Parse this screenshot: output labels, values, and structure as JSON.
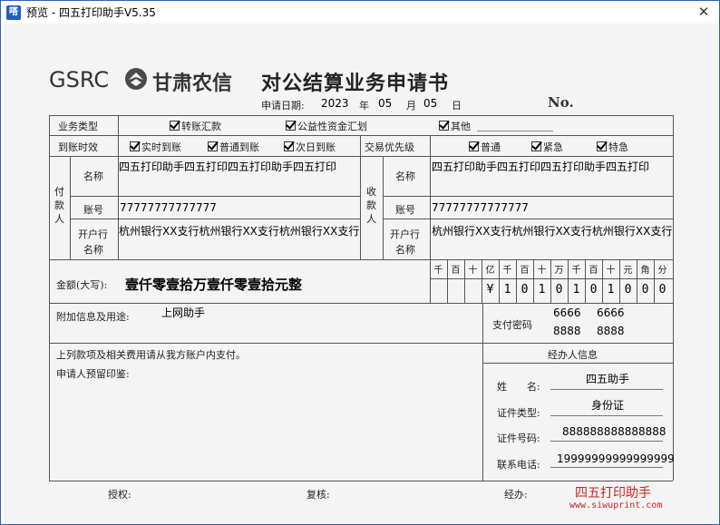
{
  "window": {
    "title": "预览 - 四五打印助手V5.35",
    "icon_text": "嗒",
    "close_glyph": "✕"
  },
  "header": {
    "brand": "GSRC",
    "bank": "甘肃农信",
    "doc_title": "对公结算业务申请书",
    "date_label": "申请日期:",
    "year": "2023",
    "year_unit": "年",
    "month": "05",
    "month_unit": "月",
    "day": "05",
    "day_unit": "日",
    "no_label": "No."
  },
  "row_type": {
    "label": "业务类型",
    "opt1": "转账汇款",
    "opt2": "公益性资金汇划",
    "opt3": "其他"
  },
  "row_time": {
    "label": "到账时效",
    "opt1": "实时到账",
    "opt2": "普通到账",
    "opt3": "次日到账",
    "priority_label": "交易优先级",
    "p1": "普通",
    "p2": "紧急",
    "p3": "特急"
  },
  "payer": {
    "side_label": "付款人",
    "name_label": "名称",
    "name": "四五打印助手四五打印四五打印助手四五打印",
    "acct_label": "账号",
    "acct": "77777777777777",
    "bank_label1": "开户行",
    "bank_label2": "名称",
    "bank": "杭州银行XX支行杭州银行XX支行杭州银行XX支行"
  },
  "payee": {
    "side_label": "收款人",
    "name_label": "名称",
    "name": "四五打印助手四五打印四五打印助手四五打印",
    "acct_label": "账号",
    "acct": "77777777777777",
    "bank_label1": "开户行",
    "bank_label2": "名称",
    "bank": "杭州银行XX支行杭州银行XX支行杭州银行XX支行"
  },
  "amount": {
    "label": "金额(大写):",
    "words": "壹仟零壹拾万壹仟零壹拾元整",
    "units": [
      "千",
      "百",
      "十",
      "亿",
      "千",
      "百",
      "十",
      "万",
      "千",
      "百",
      "十",
      "元",
      "角",
      "分"
    ],
    "digits": [
      "",
      "",
      "",
      "¥",
      "1",
      "0",
      "1",
      "0",
      "1",
      "0",
      "1",
      "0",
      "0",
      "0"
    ]
  },
  "extra": {
    "label": "附加信息及用途:",
    "value": "上网助手",
    "pwd_label": "支付密码",
    "pwd": [
      "6666",
      "6666",
      "8888",
      "8888"
    ]
  },
  "note": {
    "line1": "上列款项及相关费用请从我方账户内支付。",
    "line2": "申请人预留印鉴:"
  },
  "agent": {
    "title": "经办人信息",
    "name_label": "姓　　名:",
    "name": "四五助手",
    "idtype_label": "证件类型:",
    "idtype": "身份证",
    "idno_label": "证件号码:",
    "idno": "888888888888888",
    "phone_label": "联系电话:",
    "phone": "19999999999999999"
  },
  "footer": {
    "auth": "授权:",
    "review": "复核:",
    "handle": "经办:",
    "watermark": "四五打印助手",
    "url": "www.siwuprint.com"
  }
}
